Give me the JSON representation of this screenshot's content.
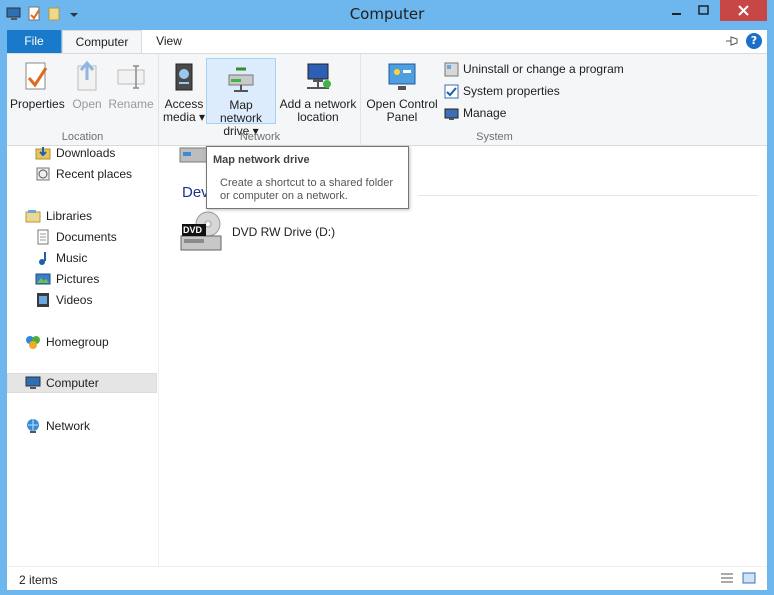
{
  "window": {
    "title": "Computer"
  },
  "tabs": [
    {
      "label": "File"
    },
    {
      "label": "Computer"
    },
    {
      "label": "View"
    }
  ],
  "ribbon": {
    "location": {
      "label": "Location",
      "properties": "Properties",
      "open": "Open",
      "rename": "Rename"
    },
    "network": {
      "label": "Network",
      "access_media_1": "Access",
      "access_media_2": "media ▾",
      "map_drive_1": "Map network",
      "map_drive_2": "drive ▾",
      "add_location_1": "Add a network",
      "add_location_2": "location"
    },
    "system": {
      "label": "System",
      "open_cp_1": "Open Control",
      "open_cp_2": "Panel",
      "uninstall": "Uninstall or change a program",
      "sys_props": "System properties",
      "manage": "Manage"
    }
  },
  "nav": {
    "downloads": "Downloads",
    "recent": "Recent places",
    "libraries": "Libraries",
    "documents": "Documents",
    "music": "Music",
    "pictures": "Pictures",
    "videos": "Videos",
    "homegroup": "Homegroup",
    "computer": "Computer",
    "network": "Network"
  },
  "main": {
    "section_header": "Dev",
    "drive_label": "DVD RW Drive (D:)",
    "drive_badge": "DVD"
  },
  "tooltip": {
    "title": "Map network drive",
    "desc": "Create a shortcut to a shared folder or computer on a network."
  },
  "status": {
    "items": "2 items"
  },
  "colors": {
    "accent": "#1979ca",
    "titlebar": "#6db6ee",
    "close": "#c74646"
  }
}
